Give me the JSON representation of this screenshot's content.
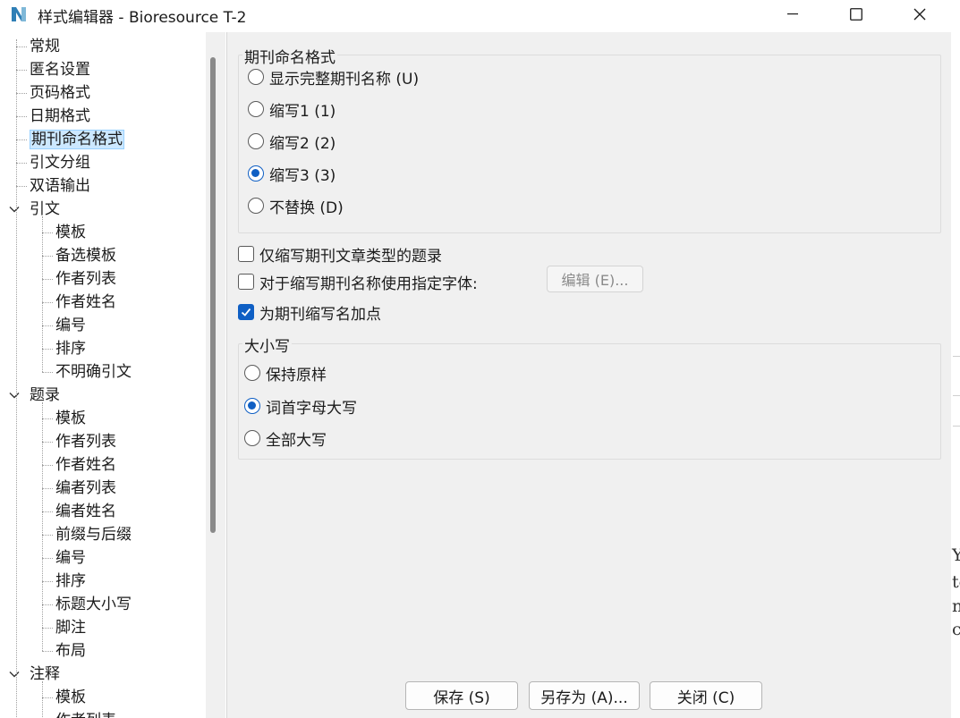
{
  "window": {
    "title": "样式编辑器 - Bioresource T-2"
  },
  "tree": {
    "items": [
      {
        "label": "常规",
        "level": 0
      },
      {
        "label": "匿名设置",
        "level": 0
      },
      {
        "label": "页码格式",
        "level": 0
      },
      {
        "label": "日期格式",
        "level": 0
      },
      {
        "label": "期刊命名格式",
        "level": 0,
        "selected": true
      },
      {
        "label": "引文分组",
        "level": 0
      },
      {
        "label": "双语输出",
        "level": 0
      },
      {
        "label": "引文",
        "level": 0,
        "expanded": true
      },
      {
        "label": "模板",
        "level": 1
      },
      {
        "label": "备选模板",
        "level": 1
      },
      {
        "label": "作者列表",
        "level": 1
      },
      {
        "label": "作者姓名",
        "level": 1
      },
      {
        "label": "编号",
        "level": 1
      },
      {
        "label": "排序",
        "level": 1
      },
      {
        "label": "不明确引文",
        "level": 1
      },
      {
        "label": "题录",
        "level": 0,
        "expanded": true
      },
      {
        "label": "模板",
        "level": 1
      },
      {
        "label": "作者列表",
        "level": 1
      },
      {
        "label": "作者姓名",
        "level": 1
      },
      {
        "label": "编者列表",
        "level": 1
      },
      {
        "label": "编者姓名",
        "level": 1
      },
      {
        "label": "前缀与后缀",
        "level": 1
      },
      {
        "label": "编号",
        "level": 1
      },
      {
        "label": "排序",
        "level": 1
      },
      {
        "label": "标题大小写",
        "level": 1
      },
      {
        "label": "脚注",
        "level": 1
      },
      {
        "label": "布局",
        "level": 1
      },
      {
        "label": "注释",
        "level": 0,
        "expanded": true
      },
      {
        "label": "模板",
        "level": 1
      },
      {
        "label": "作者列表",
        "level": 1
      }
    ]
  },
  "journal_format": {
    "title": "期刊命名格式",
    "options": [
      {
        "label": "显示完整期刊名称 (U)",
        "checked": false
      },
      {
        "label": "缩写1 (1)",
        "checked": false
      },
      {
        "label": "缩写2 (2)",
        "checked": false
      },
      {
        "label": "缩写3 (3)",
        "checked": true
      },
      {
        "label": "不替换 (D)",
        "checked": false
      }
    ]
  },
  "checkboxes": [
    {
      "label": "仅缩写期刊文章类型的题录",
      "checked": false
    },
    {
      "label": "对于缩写期刊名称使用指定字体:",
      "checked": false
    },
    {
      "label": "为期刊缩写名加点",
      "checked": true
    }
  ],
  "edit_button": "编辑 (E)...",
  "capitalization": {
    "title": "大小写",
    "options": [
      {
        "label": "保持原样",
        "checked": false
      },
      {
        "label": "词首字母大写",
        "checked": true
      },
      {
        "label": "全部大写",
        "checked": false
      }
    ]
  },
  "footer": {
    "save": "保存 (S)",
    "save_as": "另存为 (A)...",
    "close": "关闭 (C)"
  },
  "background_fragments": [
    "Y",
    "te",
    "n",
    "cl"
  ],
  "colors": {
    "accent": "#0f5fc4",
    "selection_bg": "#cce8ff",
    "panel_bg": "#f0f0f0"
  }
}
